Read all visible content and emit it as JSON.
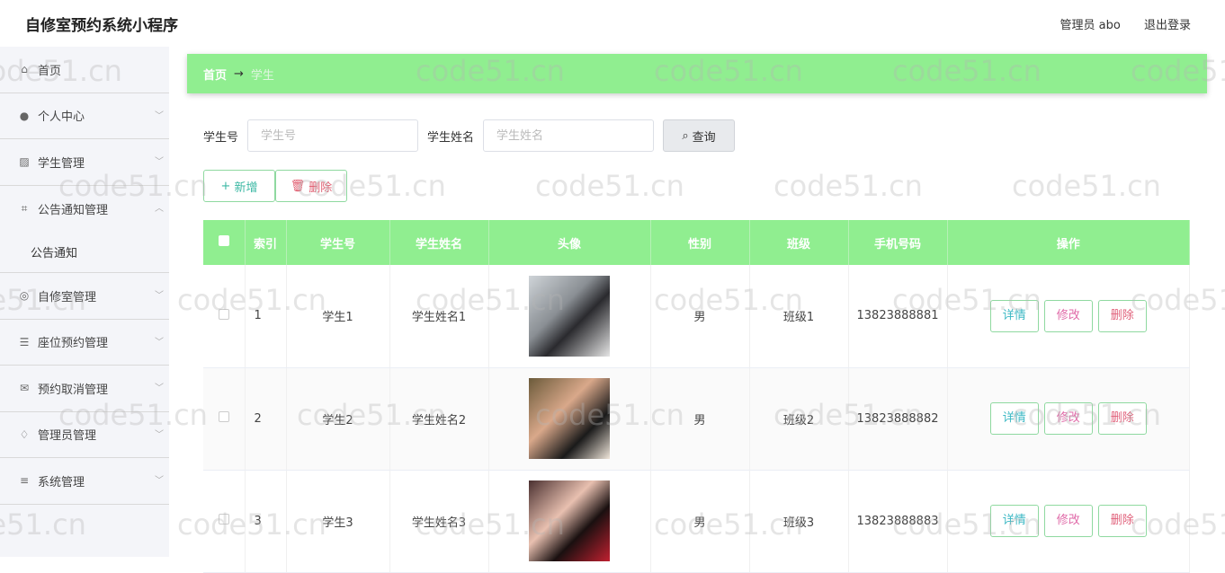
{
  "app": {
    "title": "自修室预约系统小程序",
    "user": "管理员 abo",
    "logout": "退出登录"
  },
  "sidebar": {
    "items": [
      {
        "label": "首页",
        "icon": "home-icon"
      },
      {
        "label": "个人中心",
        "icon": "user-icon"
      },
      {
        "label": "学生管理",
        "icon": "chart-icon"
      },
      {
        "label": "公告通知管理",
        "icon": "crop-icon",
        "expanded": true,
        "children": [
          {
            "label": "公告通知"
          }
        ]
      },
      {
        "label": "自修室管理",
        "icon": "circle-icon"
      },
      {
        "label": "座位预约管理",
        "icon": "list-icon"
      },
      {
        "label": "预约取消管理",
        "icon": "mail-icon"
      },
      {
        "label": "管理员管理",
        "icon": "bell-icon"
      },
      {
        "label": "系统管理",
        "icon": "menu-icon"
      }
    ]
  },
  "breadcrumb": {
    "home": "首页",
    "arrow": "→",
    "current": "学生"
  },
  "search": {
    "id_label": "学生号",
    "id_placeholder": "学生号",
    "name_label": "学生姓名",
    "name_placeholder": "学生姓名",
    "query": "查询"
  },
  "toolbar": {
    "add": "新增",
    "delete": "删除"
  },
  "table": {
    "headers": [
      "索引",
      "学生号",
      "学生姓名",
      "头像",
      "性别",
      "班级",
      "手机号码",
      "操作"
    ],
    "rows": [
      {
        "index": "1",
        "id": "学生1",
        "name": "学生姓名1",
        "gender": "男",
        "class": "班级1",
        "phone": "13823888881"
      },
      {
        "index": "2",
        "id": "学生2",
        "name": "学生姓名2",
        "gender": "男",
        "class": "班级2",
        "phone": "13823888882"
      },
      {
        "index": "3",
        "id": "学生3",
        "name": "学生姓名3",
        "gender": "男",
        "class": "班级3",
        "phone": "13823888883"
      }
    ],
    "row_actions": {
      "detail": "详情",
      "edit": "修改",
      "delete": "删除"
    }
  },
  "watermark": "code51.cn"
}
